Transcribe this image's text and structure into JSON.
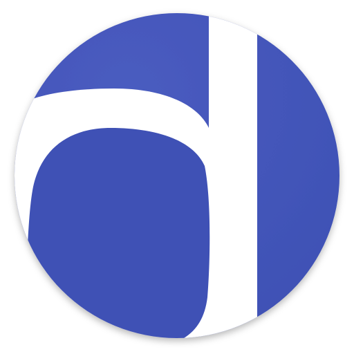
{
  "icon": {
    "name": "d-letter-logo-icon",
    "letter": "d",
    "colors": {
      "badge": "#3f51b5",
      "badge_light": "#4a5cc0",
      "letter": "#ffffff",
      "background": "#ffffff"
    }
  }
}
